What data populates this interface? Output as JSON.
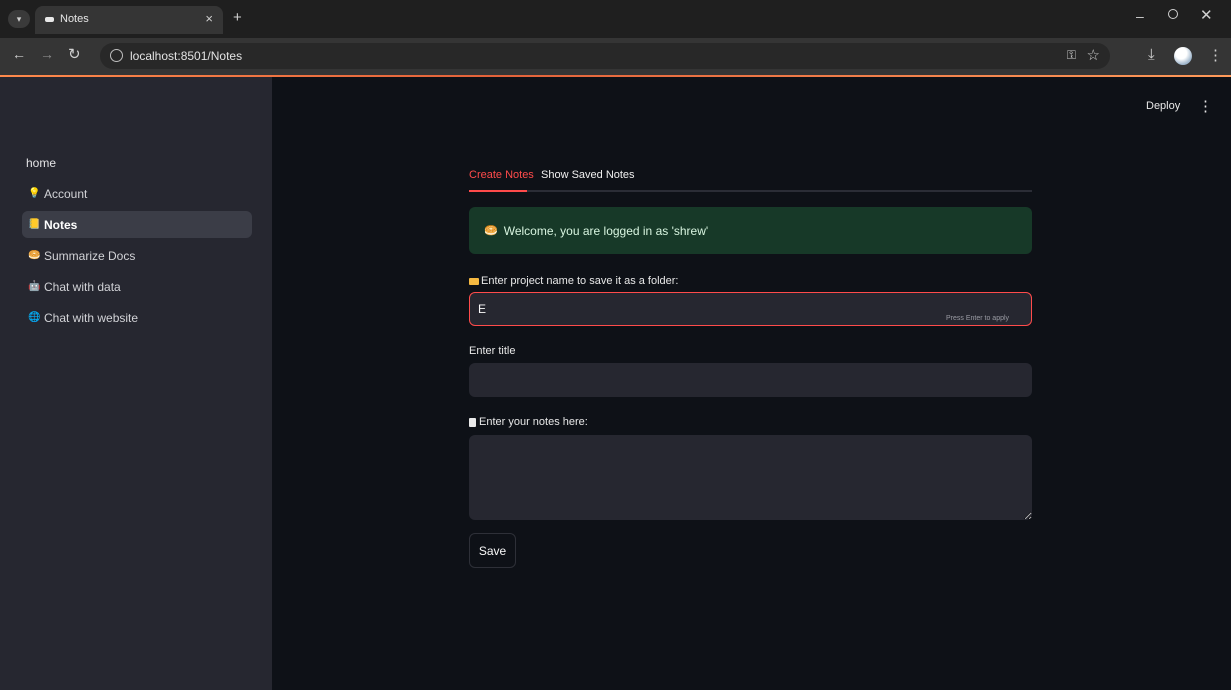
{
  "browser": {
    "tab_title": "Notes",
    "tab_close": "×",
    "new_tab": "+",
    "url": "localhost:8501/Notes",
    "window_min": "–",
    "window_close": "✕"
  },
  "sidebar": {
    "items": [
      {
        "label": "home",
        "emoji": ""
      },
      {
        "label": "Account",
        "emoji": "💡"
      },
      {
        "label": "Notes",
        "emoji": "📒"
      },
      {
        "label": "Summarize Docs",
        "emoji": "🥯"
      },
      {
        "label": "Chat with data",
        "emoji": "🤖"
      },
      {
        "label": "Chat with website",
        "emoji": "🌐"
      }
    ],
    "active_item": "Notes"
  },
  "header": {
    "deploy_label": "Deploy",
    "menu_glyph": "⋮"
  },
  "main": {
    "tabs": [
      {
        "label": "Create Notes"
      },
      {
        "label": "Show Saved Notes"
      }
    ],
    "alert": {
      "emoji": "🥯",
      "text": "Welcome, you are logged in as 'shrew'"
    },
    "project_field": {
      "label": "Enter project name to save it as a folder:",
      "value": "E",
      "hint": "Press Enter to apply"
    },
    "title_field": {
      "label": "Enter title",
      "value": ""
    },
    "notes_field": {
      "label": "Enter your notes here:",
      "value": ""
    },
    "save_label": "Save"
  },
  "colors": {
    "accent": "#ff4b4b",
    "success_bg": "#173928",
    "sidebar_bg": "#262730",
    "app_bg": "#0e1117"
  }
}
